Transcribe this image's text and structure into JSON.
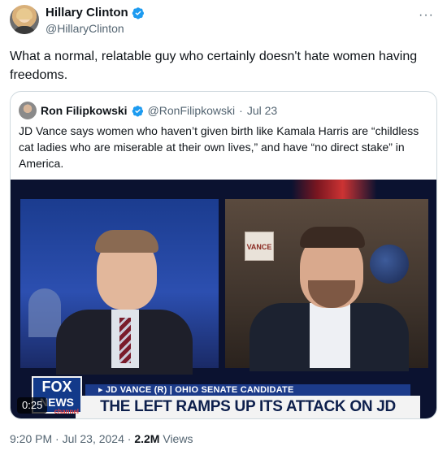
{
  "author": {
    "display_name": "Hillary Clinton",
    "handle": "@HillaryClinton"
  },
  "more_glyph": "···",
  "tweet_text": "What a normal, relatable guy who certainly doesn't hate women having freedoms.",
  "quoted": {
    "display_name": "Ron Filipkowski",
    "handle": "@RonFilipkowski",
    "separator": "·",
    "date": "Jul 23",
    "text": "JD Vance says women who haven’t given birth like Kamala Harris are “childless cat ladies who are miserable at their own lives,” and have “no direct stake” in America.",
    "video": {
      "duration": "0:25",
      "network_logo_line1": "FOX",
      "network_logo_line2": "NEWS",
      "network_logo_line3": "channel",
      "chyron_top": "▸ JD VANCE (R) | OHIO SENATE CANDIDATE",
      "chyron_main": "THE LEFT RAMPS UP ITS ATTACK ON JD VANCE",
      "background_sign": "VANCE"
    }
  },
  "meta": {
    "time": "9:20 PM",
    "sep1": "·",
    "date": "Jul 23, 2024",
    "sep2": "·",
    "views_count": "2.2M",
    "views_label": "Views"
  },
  "colors": {
    "verified_blue": "#1d9bf0",
    "text_primary": "#0f1419",
    "text_secondary": "#536471",
    "border": "#cfd9de"
  },
  "icons": {
    "verified": "verified-badge-icon",
    "more": "more-options-icon"
  }
}
